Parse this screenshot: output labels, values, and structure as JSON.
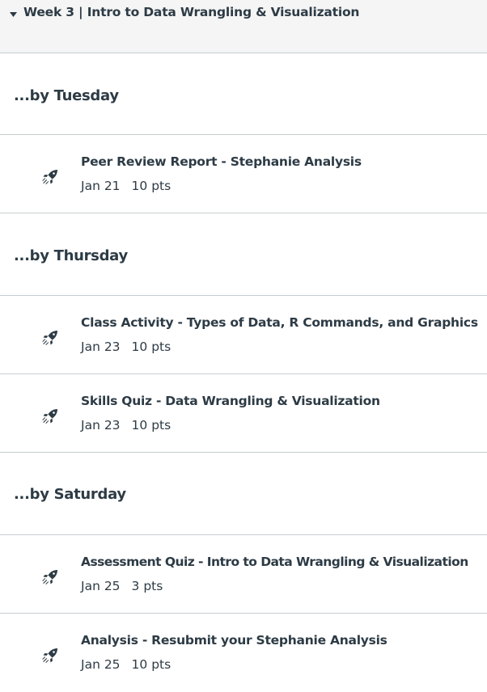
{
  "module": {
    "title": "Week 3 | Intro to Data Wrangling & Visualization",
    "toggle_icon": "caret-down-icon"
  },
  "groups": [
    {
      "label": "...by Tuesday",
      "items": [
        {
          "title": "Peer Review Report - Stephanie Analysis",
          "due": "Jan 21",
          "points": "10 pts",
          "icon": "rocket-icon"
        }
      ]
    },
    {
      "label": "...by Thursday",
      "items": [
        {
          "title": "Class Activity - Types of Data, R Commands, and Graphics",
          "due": "Jan 23",
          "points": "10 pts",
          "icon": "rocket-icon"
        },
        {
          "title": "Skills Quiz - Data Wrangling & Visualization",
          "due": "Jan 23",
          "points": "10 pts",
          "icon": "rocket-icon"
        }
      ]
    },
    {
      "label": "...by Saturday",
      "items": [
        {
          "title": "Assessment Quiz - Intro to Data Wrangling & Visualization",
          "due": "Jan 25",
          "points": "3 pts",
          "icon": "rocket-icon"
        },
        {
          "title": "Analysis - Resubmit your Stephanie Analysis",
          "due": "Jan 25",
          "points": "10 pts",
          "icon": "rocket-icon"
        }
      ]
    }
  ],
  "colors": {
    "text": "#2d3b45",
    "header_bg": "#f5f5f5",
    "divider": "#c7cdd1"
  }
}
